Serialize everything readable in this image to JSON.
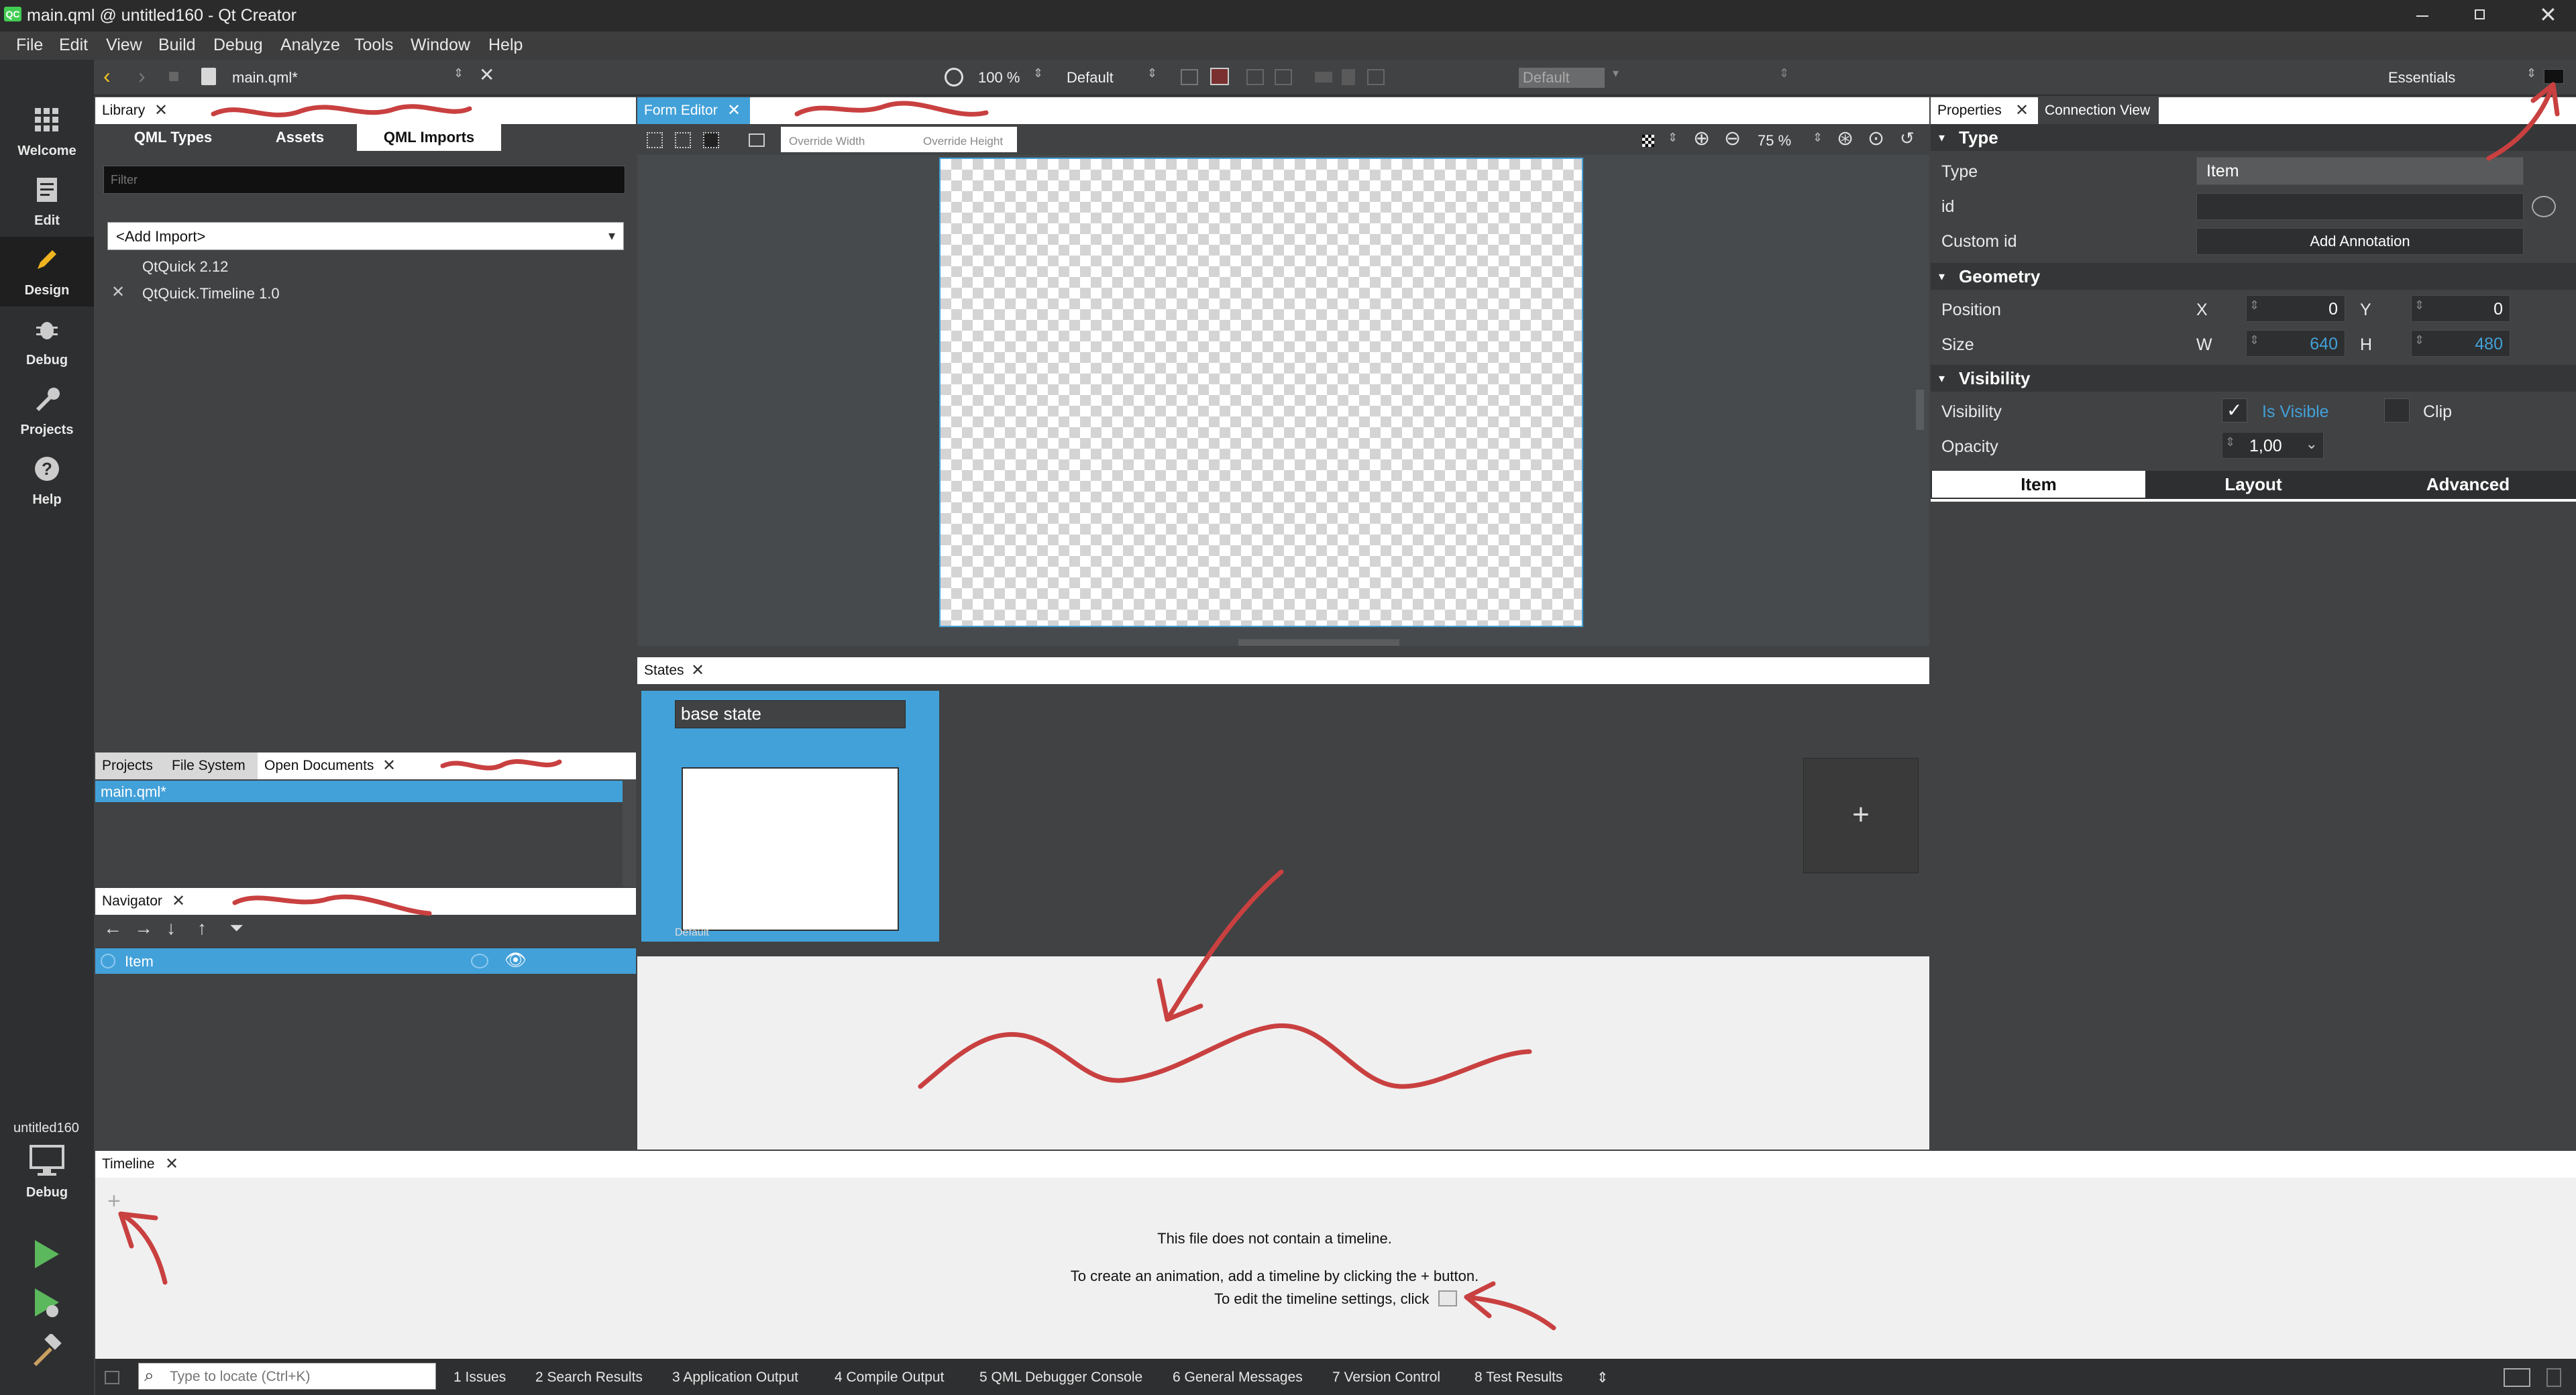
{
  "window": {
    "title": "main.qml @ untitled160 - Qt Creator",
    "app_icon": "qt-creator-icon"
  },
  "menu": [
    "File",
    "Edit",
    "View",
    "Build",
    "Debug",
    "Analyze",
    "Tools",
    "Window",
    "Help"
  ],
  "toolbar": {
    "file": "main.qml*",
    "zoom": "100 %",
    "style": "Default",
    "theme": "Default",
    "workspace": "Essentials"
  },
  "modes": [
    {
      "label": "Welcome",
      "icon": "grid-icon"
    },
    {
      "label": "Edit",
      "icon": "document-icon"
    },
    {
      "label": "Design",
      "icon": "pen-icon"
    },
    {
      "label": "Debug",
      "icon": "bug-icon"
    },
    {
      "label": "Projects",
      "icon": "wrench-icon"
    },
    {
      "label": "Help",
      "icon": "help-icon"
    }
  ],
  "kit": {
    "project": "untitled160",
    "mode": "Debug"
  },
  "library": {
    "tab": "Library",
    "subtabs": [
      "QML Types",
      "Assets",
      "QML Imports"
    ],
    "filter_placeholder": "Filter",
    "add_import": "<Add Import>",
    "imports": [
      "QtQuick 2.12",
      "QtQuick.Timeline 1.0"
    ]
  },
  "documents": {
    "tabs": [
      "Projects",
      "File System",
      "Open Documents"
    ],
    "items": [
      "main.qml*"
    ]
  },
  "navigator": {
    "tab": "Navigator",
    "items": [
      "Item"
    ]
  },
  "form_editor": {
    "tab": "Form Editor",
    "override_width": "Override Width",
    "override_height": "Override Height",
    "zoom": "75 %"
  },
  "states": {
    "tab": "States",
    "base_state": "base state",
    "default_label": "Default",
    "add": "+"
  },
  "properties": {
    "tabs": [
      "Properties",
      "Connection View"
    ],
    "sections": [
      "Type",
      "Geometry",
      "Visibility"
    ],
    "type_label": "Type",
    "type_value": "Item",
    "id_label": "id",
    "custom_id_label": "Custom id",
    "add_annotation": "Add Annotation",
    "position_label": "Position",
    "x_label": "X",
    "x_value": "0",
    "y_label": "Y",
    "y_value": "0",
    "size_label": "Size",
    "w_label": "W",
    "w_value": "640",
    "h_label": "H",
    "h_value": "480",
    "visibility_label": "Visibility",
    "is_visible": "Is Visible",
    "clip": "Clip",
    "opacity_label": "Opacity",
    "opacity_value": "1,00",
    "bottom_tabs": [
      "Item",
      "Layout",
      "Advanced"
    ]
  },
  "timeline": {
    "tab": "Timeline",
    "message1": "This file does not contain a timeline.",
    "message2": "To create an animation, add a timeline by clicking the + button.",
    "message3": "To edit the timeline settings, click"
  },
  "statusbar": {
    "locate_placeholder": "Type to locate (Ctrl+K)",
    "items": [
      "1  Issues",
      "2  Search Results",
      "3  Application Output",
      "4  Compile Output",
      "5  QML Debugger Console",
      "6  General Messages",
      "7  Version Control",
      "8  Test Results"
    ]
  },
  "colors": {
    "accent": "#43a1d9",
    "annotation": "#c94040",
    "timeline_bg": "#f0f0f0"
  }
}
